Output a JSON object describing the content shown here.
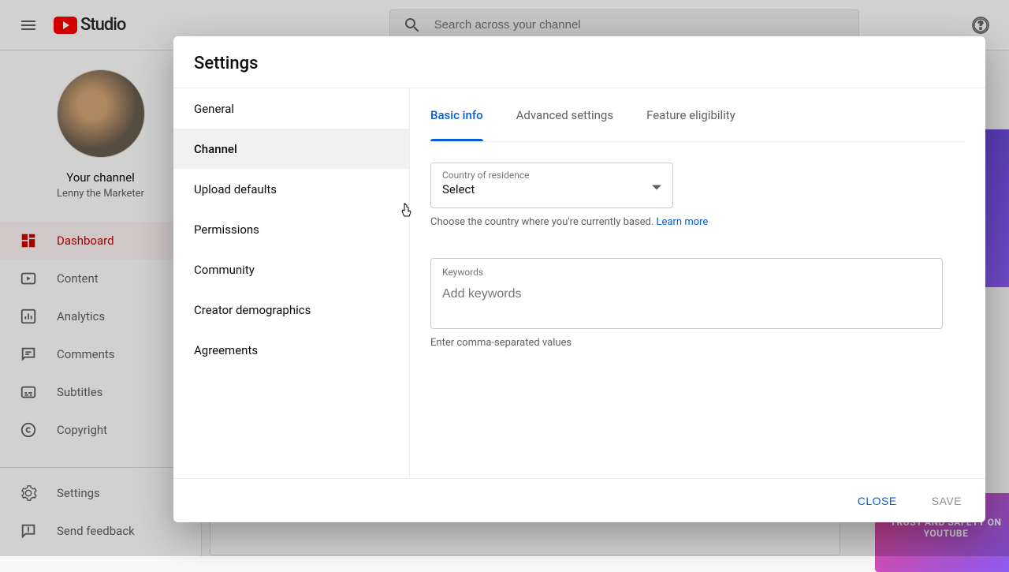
{
  "header": {
    "logo_text": "Studio",
    "search_placeholder": "Search across your channel"
  },
  "sidebar": {
    "channel_label": "Your channel",
    "channel_name": "Lenny the Marketer",
    "items": [
      {
        "label": "Dashboard",
        "icon": "dashboard-icon"
      },
      {
        "label": "Content",
        "icon": "content-icon"
      },
      {
        "label": "Analytics",
        "icon": "analytics-icon"
      },
      {
        "label": "Comments",
        "icon": "comments-icon"
      },
      {
        "label": "Subtitles",
        "icon": "subtitles-icon"
      },
      {
        "label": "Copyright",
        "icon": "copyright-icon"
      }
    ],
    "bottom": [
      {
        "label": "Settings",
        "icon": "gear-icon"
      },
      {
        "label": "Send feedback",
        "icon": "feedback-icon"
      }
    ]
  },
  "modal": {
    "title": "Settings",
    "sidebar_items": [
      "General",
      "Channel",
      "Upload defaults",
      "Permissions",
      "Community",
      "Creator demographics",
      "Agreements"
    ],
    "selected_sidebar_index": 1,
    "tabs": [
      "Basic info",
      "Advanced settings",
      "Feature eligibility"
    ],
    "active_tab_index": 0,
    "country": {
      "label": "Country of residence",
      "value": "Select",
      "helper": "Choose the country where you're currently based. ",
      "learn_more": "Learn more"
    },
    "keywords": {
      "label": "Keywords",
      "placeholder": "Add keywords",
      "helper": "Enter comma-separated values"
    },
    "close_label": "CLOSE",
    "save_label": "SAVE"
  },
  "promo2_text": "TRUST AND SAFETY ON YOUTUBE"
}
